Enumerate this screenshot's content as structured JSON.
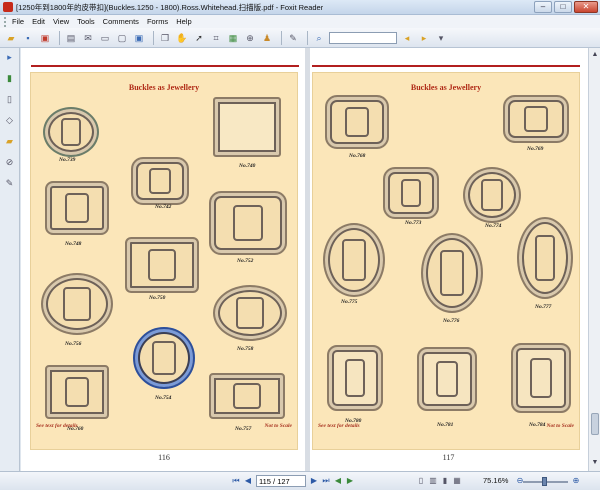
{
  "window": {
    "title": "[1250年到1800年的皮带扣](Buckles.1250 - 1800).Ross.Whitehead.扫描版.pdf - Foxit Reader",
    "minimize": "–",
    "maximize": "□",
    "close": "✕"
  },
  "menu": [
    "File",
    "Edit",
    "View",
    "Tools",
    "Comments",
    "Forms",
    "Help"
  ],
  "toolbar_icons": [
    "open-icon",
    "save-icon",
    "pdf-icon",
    "print-icon",
    "email-icon",
    "fit-icon",
    "window-icon",
    "screen-icon",
    "copy-icon",
    "hand-icon",
    "select-icon",
    "snapshot-icon",
    "image-icon",
    "zoom-icon",
    "stamp-icon",
    "typewriter-icon",
    "find-icon",
    "search-prev-icon",
    "search-next-icon"
  ],
  "sidebar_icons": [
    "bookmark-icon",
    "pages-icon",
    "layers-icon",
    "comments-icon",
    "attachments-icon",
    "signatures-icon"
  ],
  "left_page": {
    "heading": "Buckles as Jewellery",
    "labels": [
      "No.739",
      "No.740",
      "No.742",
      "No.748",
      "No.752",
      "No.750",
      "No.756",
      "No.758",
      "No.754",
      "No.760",
      "No.757"
    ],
    "footer_left": "See text for details",
    "footer_right": "Not to Scale",
    "page_number": "116"
  },
  "right_page": {
    "heading": "Buckles as Jewellery",
    "labels": [
      "No.768",
      "No.769",
      "No.773",
      "No.774",
      "No.775",
      "No.776",
      "No.777",
      "No.780",
      "No.781",
      "No.784"
    ],
    "footer_left": "See text for details",
    "footer_right": "Not to Scale",
    "page_number": "117"
  },
  "status": {
    "page_field": "115 / 127",
    "zoom": "75.16%"
  }
}
